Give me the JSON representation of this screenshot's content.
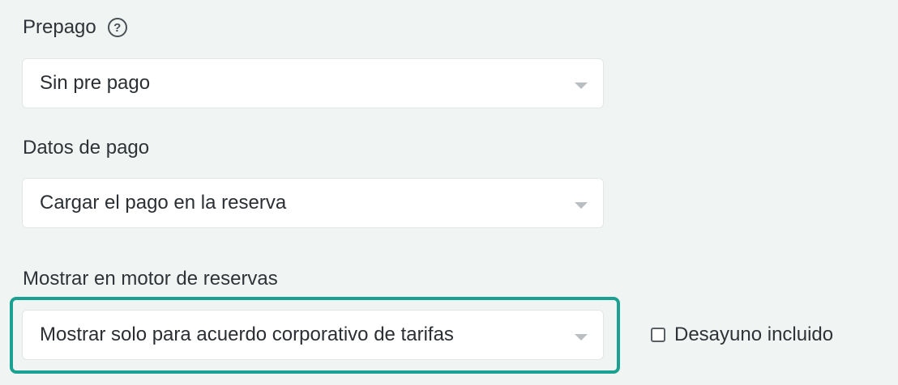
{
  "prepago": {
    "label": "Prepago",
    "help_icon_glyph": "?",
    "selected_value": "Sin pre pago"
  },
  "datos_pago": {
    "label": "Datos de pago",
    "selected_value": "Cargar el pago en la reserva"
  },
  "motor_reservas": {
    "label": "Mostrar en motor de reservas",
    "selected_value": "Mostrar solo para acuerdo corporativo de tarifas"
  },
  "desayuno": {
    "label": "Desayuno incluido",
    "checked": false
  },
  "colors": {
    "background": "#f0f5f4",
    "highlight_border": "#1aa191",
    "caret": "#b9bec2"
  }
}
